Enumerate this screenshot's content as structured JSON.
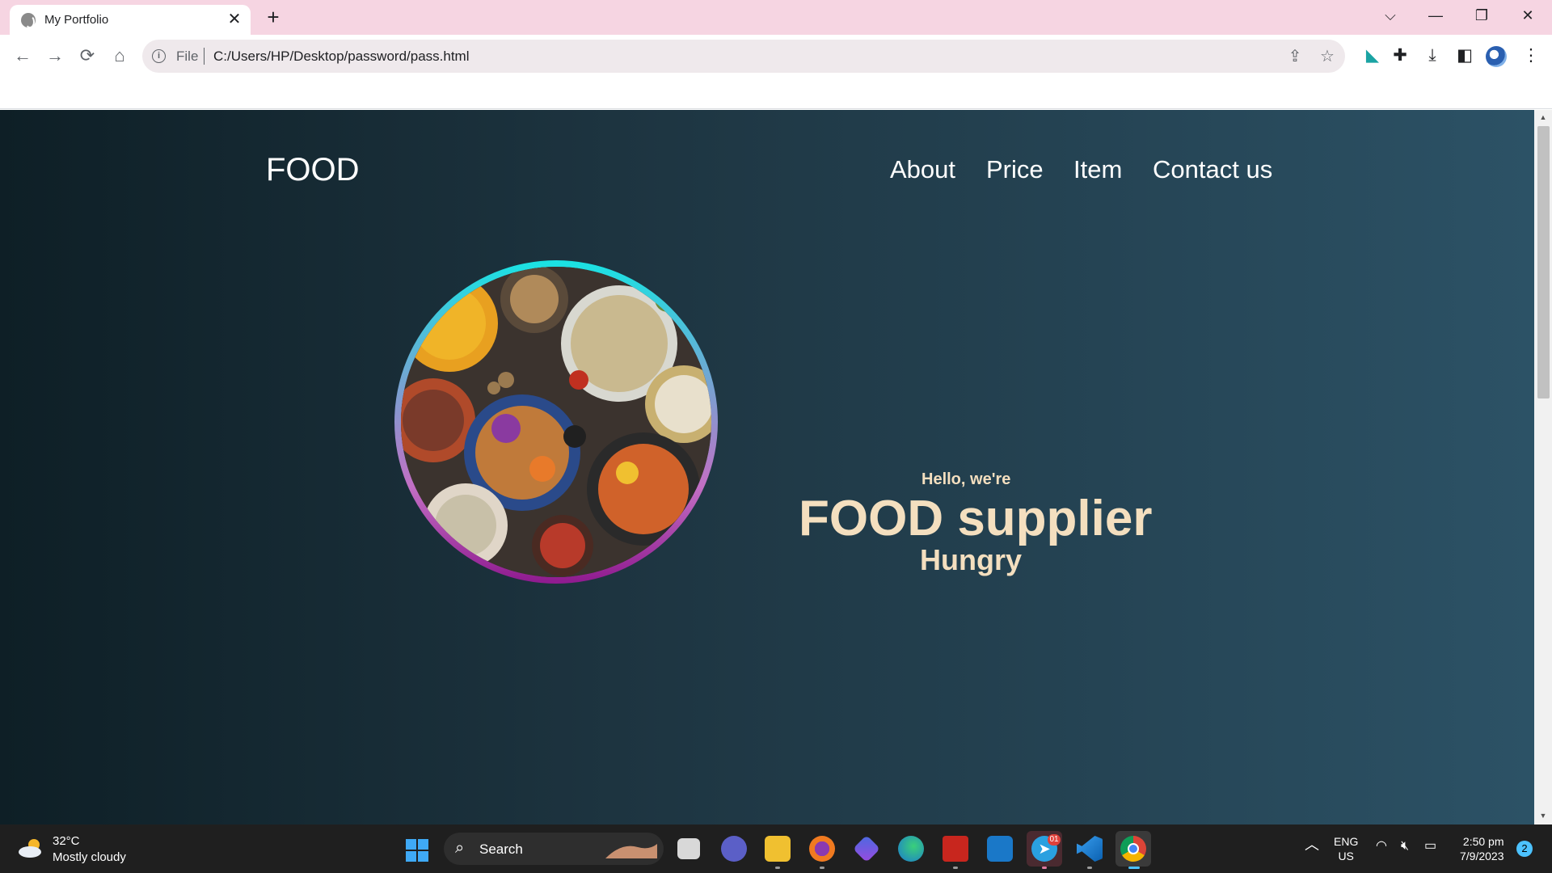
{
  "browser": {
    "tab_title": "My Portfolio",
    "url_scheme": "File",
    "url": "C:/Users/HP/Desktop/password/pass.html"
  },
  "site": {
    "logo": "FOOD",
    "nav": [
      "About",
      "Price",
      "Item",
      "Contact us"
    ],
    "hero": {
      "greeting": "Hello, we're",
      "headline": "FOOD supplier",
      "tagline": "Hungry"
    }
  },
  "taskbar": {
    "weather_temp": "32°C",
    "weather_cond": "Mostly cloudy",
    "search_label": "Search",
    "lang_top": "ENG",
    "lang_bottom": "US",
    "time": "2:50 pm",
    "date": "7/9/2023",
    "notification_count": "2",
    "telegram_badge": "01"
  },
  "colors": {
    "accent_text": "#f4dfbf",
    "page_bg_start": "#0e1f26",
    "page_bg_end": "#2c5266",
    "ring_top": "#19e3e3",
    "ring_bottom": "#8f1a8f"
  }
}
